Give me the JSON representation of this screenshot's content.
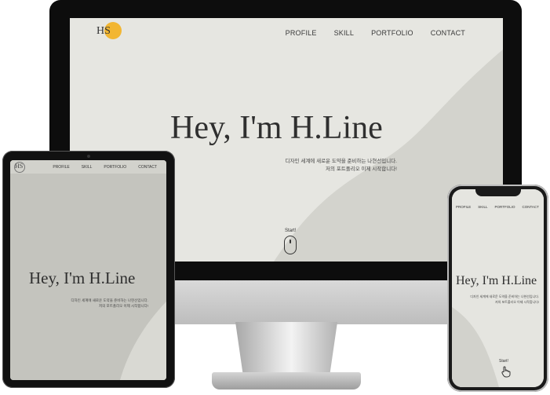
{
  "site": {
    "nav": [
      "PROFILE",
      "SKILL",
      "PORTFOLIO",
      "CONTACT"
    ],
    "headline": "Hey, I'm H.Line",
    "intro_line1": "디자인 세계에 새로운 도약을 준비하는 나현선입니다.",
    "intro_line2": "저의 포트폴리오 이제 시작합니다!",
    "start_label": "Start!",
    "logo_text": "HS"
  },
  "colors": {
    "accent": "#f2b632",
    "screen_bg": "#d6d6d0",
    "wave_light": "#e7e7e2",
    "text_dark": "#2f2f2f"
  },
  "icons": {
    "imac_scroll": "mouse-scroll-icon",
    "phone_scroll": "touch-hand-icon"
  }
}
